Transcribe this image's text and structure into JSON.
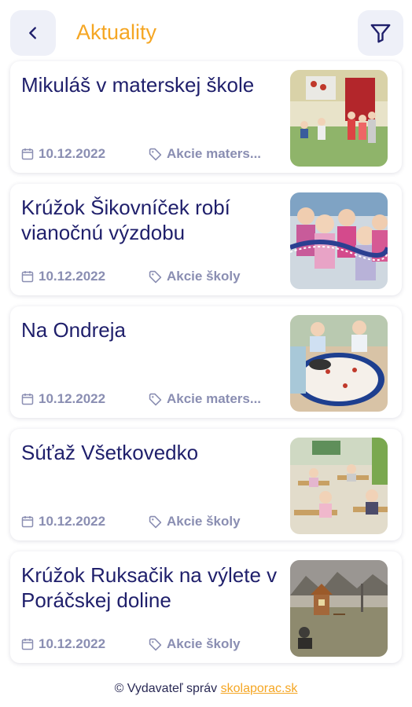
{
  "header": {
    "title": "Aktuality",
    "back_icon": "chevron-left-icon",
    "filter_icon": "filter-icon"
  },
  "colors": {
    "accent": "#f5a623",
    "title_text": "#1f1f6b",
    "meta_text": "#8a8eb2",
    "button_bg": "#eef0f8"
  },
  "articles": [
    {
      "title": "Mikuláš v materskej škole",
      "date": "10.12.2022",
      "category": "Akcie materské školy",
      "category_display": "Akcie maters..."
    },
    {
      "title": "Krúžok Šikovníček robí vianočnú výzdobu",
      "date": "10.12.2022",
      "category": "Akcie školy",
      "category_display": "Akcie školy"
    },
    {
      "title": "Na Ondreja",
      "date": "10.12.2022",
      "category": "Akcie materské školy",
      "category_display": "Akcie maters..."
    },
    {
      "title": "Súťaž Všetkovedko",
      "date": "10.12.2022",
      "category": "Akcie školy",
      "category_display": "Akcie školy"
    },
    {
      "title": "Krúžok Ruksačik na výlete v Poráčskej doline",
      "date": "10.12.2022",
      "category": "Akcie školy",
      "category_display": "Akcie školy"
    }
  ],
  "footer": {
    "prefix": "© Vydavateľ správ",
    "link": "skolaporac.sk"
  }
}
